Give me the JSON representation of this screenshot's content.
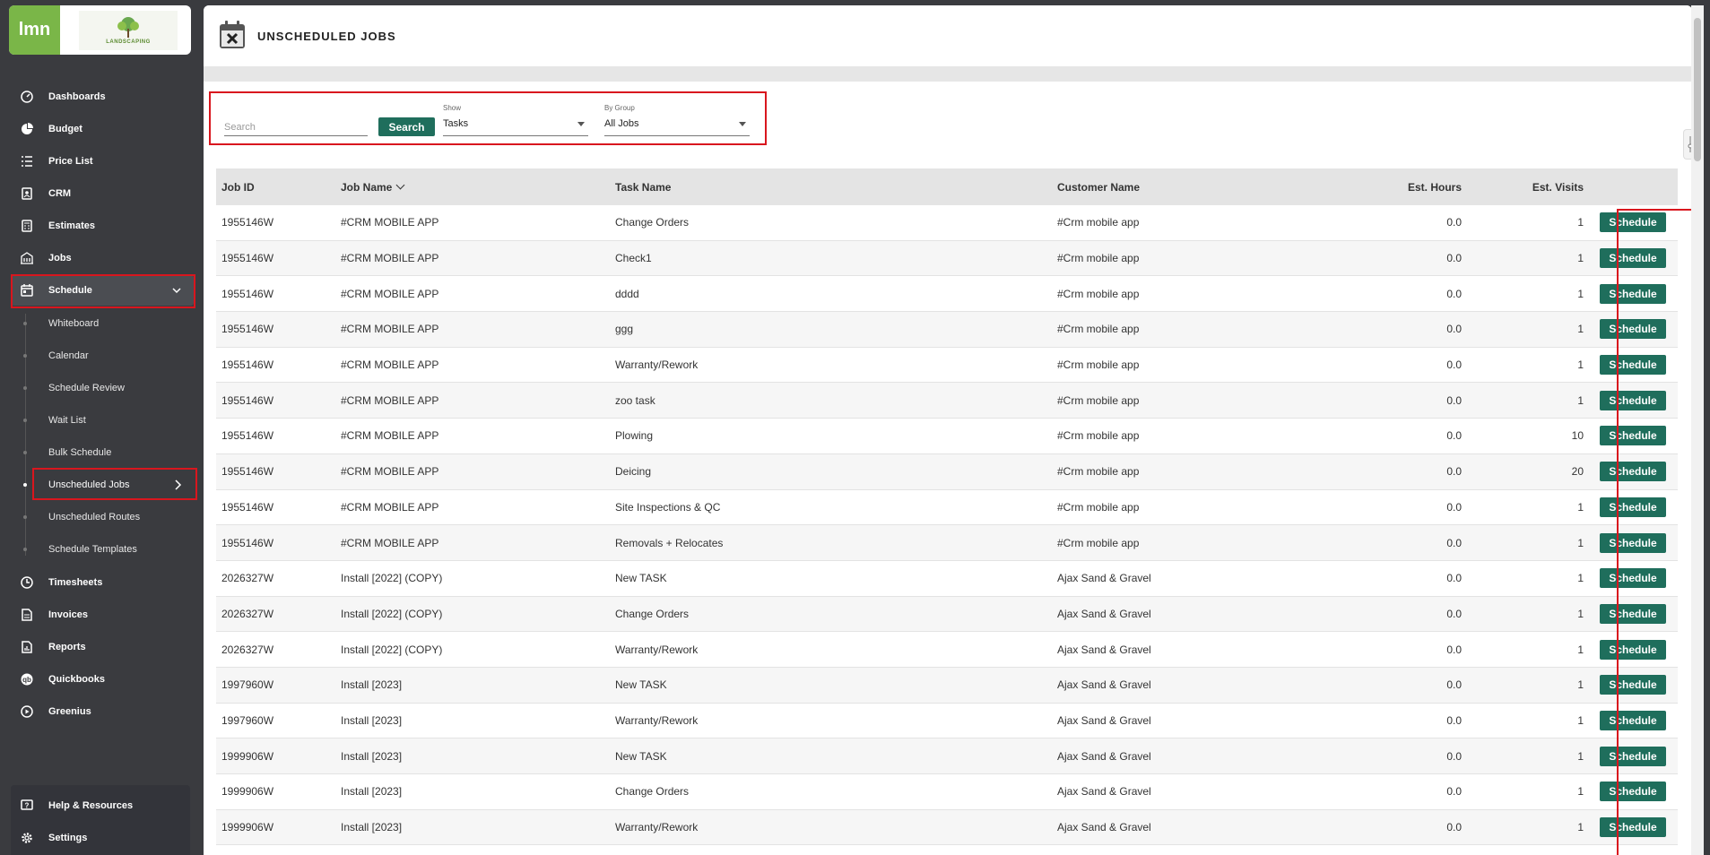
{
  "sidebar": {
    "logo_text": "lmn",
    "company_logo_text": "LANDSCAPING",
    "items": [
      {
        "label": "Dashboards",
        "icon": "gauge-icon"
      },
      {
        "label": "Budget",
        "icon": "pie-chart-icon"
      },
      {
        "label": "Price List",
        "icon": "list-icon"
      },
      {
        "label": "CRM",
        "icon": "contacts-icon"
      },
      {
        "label": "Estimates",
        "icon": "calculator-icon"
      },
      {
        "label": "Jobs",
        "icon": "building-icon"
      },
      {
        "label": "Schedule",
        "icon": "calendar-icon"
      }
    ],
    "schedule_sub": [
      {
        "label": "Whiteboard"
      },
      {
        "label": "Calendar"
      },
      {
        "label": "Schedule Review"
      },
      {
        "label": "Wait List"
      },
      {
        "label": "Bulk Schedule"
      },
      {
        "label": "Unscheduled Jobs"
      },
      {
        "label": "Unscheduled Routes"
      },
      {
        "label": "Schedule Templates"
      }
    ],
    "items_after": [
      {
        "label": "Timesheets",
        "icon": "clock-icon"
      },
      {
        "label": "Invoices",
        "icon": "invoice-icon"
      },
      {
        "label": "Reports",
        "icon": "report-icon"
      },
      {
        "label": "Quickbooks",
        "icon": "quickbooks-icon"
      },
      {
        "label": "Greenius",
        "icon": "play-circle-icon"
      }
    ],
    "footer": [
      {
        "label": "Help & Resources",
        "icon": "help-icon"
      },
      {
        "label": "Settings",
        "icon": "gear-icon"
      }
    ]
  },
  "header": {
    "title": "UNSCHEDULED JOBS"
  },
  "filters": {
    "search_placeholder": "Search",
    "search_button": "Search",
    "show_label": "Show",
    "show_value": "Tasks",
    "group_label": "By Group",
    "group_value": "All Jobs"
  },
  "table": {
    "columns": [
      "Job ID",
      "Job Name",
      "Task Name",
      "Customer Name",
      "Est. Hours",
      "Est. Visits"
    ],
    "action_label": "Schedule",
    "rows": [
      {
        "id": "1955146W",
        "job": "#CRM MOBILE APP",
        "task": "Change Orders",
        "customer": "#Crm mobile app",
        "hours": "0.0",
        "visits": "1"
      },
      {
        "id": "1955146W",
        "job": "#CRM MOBILE APP",
        "task": "Check1",
        "customer": "#Crm mobile app",
        "hours": "0.0",
        "visits": "1"
      },
      {
        "id": "1955146W",
        "job": "#CRM MOBILE APP",
        "task": "dddd",
        "customer": "#Crm mobile app",
        "hours": "0.0",
        "visits": "1"
      },
      {
        "id": "1955146W",
        "job": "#CRM MOBILE APP",
        "task": "ggg",
        "customer": "#Crm mobile app",
        "hours": "0.0",
        "visits": "1"
      },
      {
        "id": "1955146W",
        "job": "#CRM MOBILE APP",
        "task": "Warranty/Rework",
        "customer": "#Crm mobile app",
        "hours": "0.0",
        "visits": "1"
      },
      {
        "id": "1955146W",
        "job": "#CRM MOBILE APP",
        "task": "zoo task",
        "customer": "#Crm mobile app",
        "hours": "0.0",
        "visits": "1"
      },
      {
        "id": "1955146W",
        "job": "#CRM MOBILE APP",
        "task": "Plowing",
        "customer": "#Crm mobile app",
        "hours": "0.0",
        "visits": "10"
      },
      {
        "id": "1955146W",
        "job": "#CRM MOBILE APP",
        "task": "Deicing",
        "customer": "#Crm mobile app",
        "hours": "0.0",
        "visits": "20"
      },
      {
        "id": "1955146W",
        "job": "#CRM MOBILE APP",
        "task": "Site Inspections & QC",
        "customer": "#Crm mobile app",
        "hours": "0.0",
        "visits": "1"
      },
      {
        "id": "1955146W",
        "job": "#CRM MOBILE APP",
        "task": "Removals + Relocates",
        "customer": "#Crm mobile app",
        "hours": "0.0",
        "visits": "1"
      },
      {
        "id": "2026327W",
        "job": "Install [2022] (COPY)",
        "task": "New TASK",
        "customer": "Ajax Sand & Gravel",
        "hours": "0.0",
        "visits": "1"
      },
      {
        "id": "2026327W",
        "job": "Install [2022] (COPY)",
        "task": "Change Orders",
        "customer": "Ajax Sand & Gravel",
        "hours": "0.0",
        "visits": "1"
      },
      {
        "id": "2026327W",
        "job": "Install [2022] (COPY)",
        "task": "Warranty/Rework",
        "customer": "Ajax Sand & Gravel",
        "hours": "0.0",
        "visits": "1"
      },
      {
        "id": "1997960W",
        "job": "Install [2023]",
        "task": "New TASK",
        "customer": "Ajax Sand & Gravel",
        "hours": "0.0",
        "visits": "1"
      },
      {
        "id": "1997960W",
        "job": "Install [2023]",
        "task": "Warranty/Rework",
        "customer": "Ajax Sand & Gravel",
        "hours": "0.0",
        "visits": "1"
      },
      {
        "id": "1999906W",
        "job": "Install [2023]",
        "task": "New TASK",
        "customer": "Ajax Sand & Gravel",
        "hours": "0.0",
        "visits": "1"
      },
      {
        "id": "1999906W",
        "job": "Install [2023]",
        "task": "Change Orders",
        "customer": "Ajax Sand & Gravel",
        "hours": "0.0",
        "visits": "1"
      },
      {
        "id": "1999906W",
        "job": "Install [2023]",
        "task": "Warranty/Rework",
        "customer": "Ajax Sand & Gravel",
        "hours": "0.0",
        "visits": "1"
      }
    ]
  },
  "colors": {
    "accent": "#1f6e5c",
    "brand": "#7ab648",
    "highlight": "#d9161e",
    "sidebar": "#3a3b3f"
  }
}
